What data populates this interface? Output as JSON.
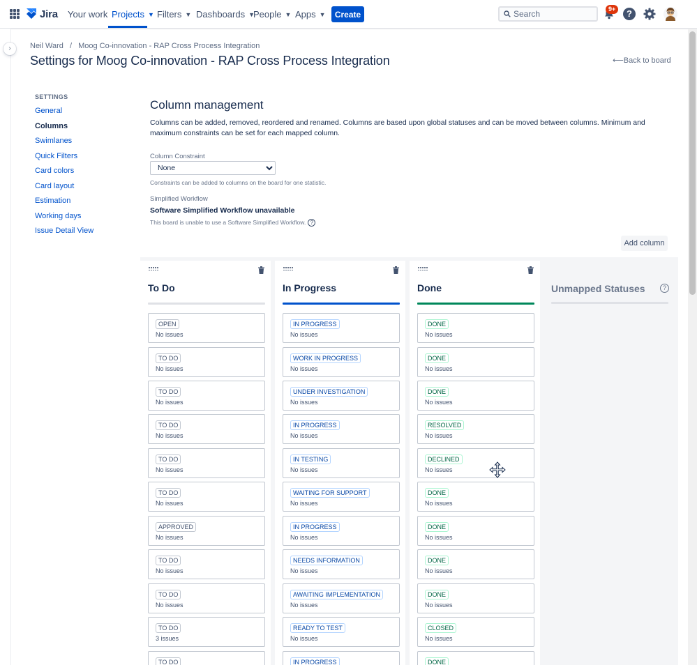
{
  "nav": {
    "logo_text": "Jira",
    "items": [
      {
        "label": "Your work",
        "caret": false
      },
      {
        "label": "Projects",
        "caret": true,
        "active": true
      },
      {
        "label": "Filters",
        "caret": true
      },
      {
        "label": "Dashboards",
        "caret": true
      },
      {
        "label": "People",
        "caret": true
      },
      {
        "label": "Apps",
        "caret": true
      }
    ],
    "create_label": "Create",
    "search_placeholder": "Search",
    "notification_badge": "9+",
    "help_glyph": "?",
    "accent_color": "#0052cc"
  },
  "breadcrumb": {
    "items": [
      "Neil Ward",
      "Moog Co-innovation - RAP Cross Process Integration"
    ],
    "separator": "/"
  },
  "page": {
    "title": "Settings for Moog Co-innovation - RAP Cross Process Integration",
    "back_link": "Back to board"
  },
  "settings_nav": {
    "heading": "SETTINGS",
    "items": [
      {
        "label": "General",
        "active": false
      },
      {
        "label": "Columns",
        "active": true
      },
      {
        "label": "Swimlanes",
        "active": false
      },
      {
        "label": "Quick Filters",
        "active": false
      },
      {
        "label": "Card colors",
        "active": false
      },
      {
        "label": "Card layout",
        "active": false
      },
      {
        "label": "Estimation",
        "active": false
      },
      {
        "label": "Working days",
        "active": false
      },
      {
        "label": "Issue Detail View",
        "active": false
      }
    ]
  },
  "main": {
    "heading": "Column management",
    "description": "Columns can be added, removed, reordered and renamed. Columns are based upon global statuses and can be moved between columns. Minimum and maximum constraints can be set for each mapped column.",
    "constraint_label": "Column Constraint",
    "constraint_value": "None",
    "constraint_help": "Constraints can be added to columns on the board for one statistic.",
    "workflow_label": "Simplified Workflow",
    "workflow_title": "Software Simplified Workflow unavailable",
    "workflow_help": "This board is unable to use a Software Simplified Workflow.",
    "add_column_label": "Add column"
  },
  "columns": [
    {
      "title": "To Do",
      "rule_color": "#dfe1e6",
      "kind": "todo",
      "cards": [
        {
          "status": "OPEN",
          "count": "No issues"
        },
        {
          "status": "TO DO",
          "count": "No issues"
        },
        {
          "status": "TO DO",
          "count": "No issues"
        },
        {
          "status": "TO DO",
          "count": "No issues"
        },
        {
          "status": "TO DO",
          "count": "No issues"
        },
        {
          "status": "TO DO",
          "count": "No issues"
        },
        {
          "status": "APPROVED",
          "count": "No issues"
        },
        {
          "status": "TO DO",
          "count": "No issues"
        },
        {
          "status": "TO DO",
          "count": "No issues"
        },
        {
          "status": "TO DO",
          "count": "3 issues"
        },
        {
          "status": "TO DO",
          "count": ""
        }
      ]
    },
    {
      "title": "In Progress",
      "rule_color": "#0052cc",
      "kind": "prog",
      "cards": [
        {
          "status": "IN PROGRESS",
          "count": "No issues"
        },
        {
          "status": "WORK IN PROGRESS",
          "count": "No issues"
        },
        {
          "status": "UNDER INVESTIGATION",
          "count": "No issues"
        },
        {
          "status": "IN PROGRESS",
          "count": "No issues"
        },
        {
          "status": "IN TESTING",
          "count": "No issues"
        },
        {
          "status": "WAITING FOR SUPPORT",
          "count": "No issues"
        },
        {
          "status": "IN PROGRESS",
          "count": "No issues"
        },
        {
          "status": "NEEDS INFORMATION",
          "count": "No issues"
        },
        {
          "status": "AWAITING IMPLEMENTATION",
          "count": "No issues"
        },
        {
          "status": "READY TO TEST",
          "count": "No issues"
        },
        {
          "status": "IN PROGRESS",
          "count": ""
        }
      ]
    },
    {
      "title": "Done",
      "rule_color": "#00875a",
      "kind": "done",
      "cards": [
        {
          "status": "DONE",
          "count": "No issues"
        },
        {
          "status": "DONE",
          "count": "No issues"
        },
        {
          "status": "DONE",
          "count": "No issues"
        },
        {
          "status": "RESOLVED",
          "count": "No issues"
        },
        {
          "status": "DECLINED",
          "count": "No issues"
        },
        {
          "status": "DONE",
          "count": "No issues"
        },
        {
          "status": "DONE",
          "count": "No issues"
        },
        {
          "status": "DONE",
          "count": "No issues"
        },
        {
          "status": "DONE",
          "count": "No issues"
        },
        {
          "status": "CLOSED",
          "count": "No issues"
        },
        {
          "status": "DONE",
          "count": ""
        }
      ]
    }
  ],
  "unmapped": {
    "title": "Unmapped Statuses",
    "help_glyph": "?"
  }
}
